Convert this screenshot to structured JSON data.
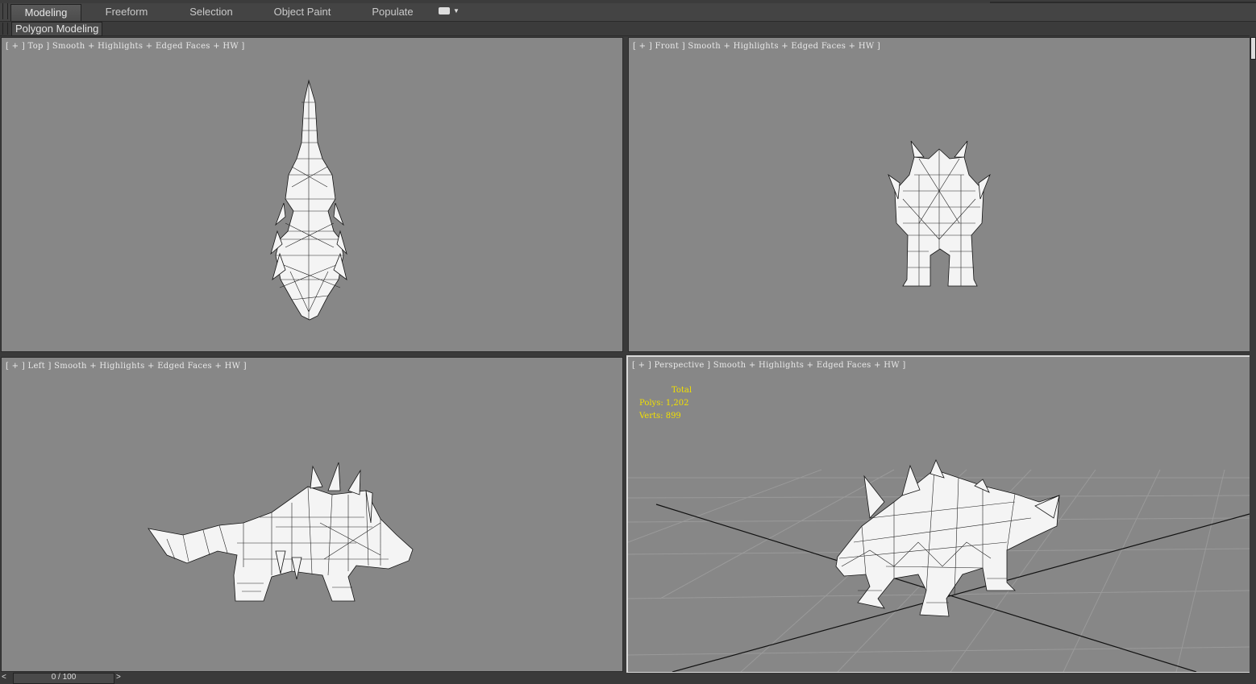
{
  "ribbon": {
    "tabs": [
      {
        "label": "Modeling",
        "active": true
      },
      {
        "label": "Freeform",
        "active": false
      },
      {
        "label": "Selection",
        "active": false
      },
      {
        "label": "Object Paint",
        "active": false
      },
      {
        "label": "Populate",
        "active": false
      }
    ],
    "extra_icon": "ribbon-options-icon",
    "sub_tab": "Polygon Modeling"
  },
  "viewports": {
    "top": {
      "label": "[ + ] Top ] Smooth + Highlights + Edged Faces + HW ]"
    },
    "front": {
      "label": "[ + ] Front ] Smooth + Highlights + Edged Faces + HW ]"
    },
    "left": {
      "label": "[ + ] Left ] Smooth + Highlights + Edged Faces + HW ]"
    },
    "perspective": {
      "label": "[ + ] Perspective ] Smooth + Highlights + Edged Faces + HW ]",
      "stats": {
        "total": "Total",
        "polys": "Polys: 1,202",
        "verts": "Verts: 899"
      }
    }
  },
  "timeline": {
    "frame": "0 / 100",
    "prev": "<",
    "next": ">"
  },
  "colors": {
    "viewport_bg": "#878787",
    "stats_text": "#f2e000",
    "ui_bg": "#444444"
  }
}
